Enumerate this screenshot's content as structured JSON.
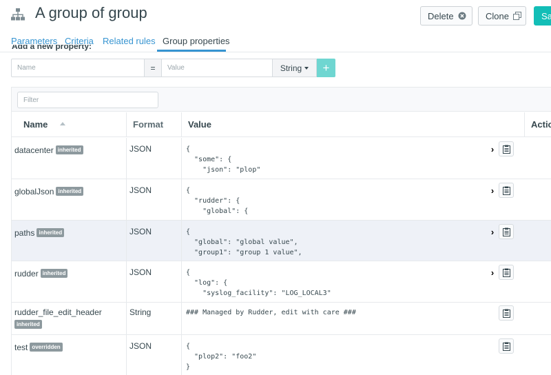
{
  "header": {
    "title": "A group of group",
    "delete_label": "Delete",
    "clone_label": "Clone",
    "save_label": "Sa"
  },
  "tabs": [
    {
      "label": "Parameters",
      "active": false
    },
    {
      "label": "Criteria",
      "active": false
    },
    {
      "label": "Related rules",
      "active": false
    },
    {
      "label": "Group properties",
      "active": true
    }
  ],
  "add_property": {
    "label": "Add a new property:",
    "name_placeholder": "Name",
    "equals": "=",
    "value_placeholder": "Value",
    "type_value": "String",
    "add_label": "+"
  },
  "table": {
    "filter_placeholder": "Filter",
    "columns": {
      "name": "Name",
      "format": "Format",
      "value": "Value",
      "action": "Actio"
    },
    "rows": [
      {
        "name": "datacenter",
        "badge": "inherited",
        "format": "JSON",
        "value": "{\n  \"some\": {\n    \"json\": \"plop\"",
        "expandable": true
      },
      {
        "name": "globalJson",
        "badge": "inherited",
        "format": "JSON",
        "value": "{\n  \"rudder\": {\n    \"global\": {",
        "expandable": true
      },
      {
        "name": "paths",
        "badge": "inherited",
        "format": "JSON",
        "value": "{\n  \"global\": \"global value\",\n  \"group1\": \"group 1 value\",",
        "expandable": true
      },
      {
        "name": "rudder",
        "badge": "inherited",
        "format": "JSON",
        "value": "{\n  \"log\": {\n    \"syslog_facility\": \"LOG_LOCAL3\"",
        "expandable": true
      },
      {
        "name": "rudder_file_edit_header",
        "badge": "inherited",
        "format": "String",
        "value": "### Managed by Rudder, edit with care ###",
        "expandable": false
      },
      {
        "name": "test",
        "badge": "overridden",
        "format": "JSON",
        "value": "{\n  \"plop2\": \"foo2\"\n}",
        "expandable": false
      }
    ]
  },
  "colors": {
    "accent": "#3694d1",
    "save": "#13beb7",
    "add": "#6fd6d1",
    "badge": "#8d999e",
    "highlight_row": "#eef1f7"
  },
  "icons": {
    "group": "hierarchy-icon",
    "delete": "close-circle-icon",
    "clone": "copy-icon",
    "expand": "chevron-right-icon",
    "copy": "clipboard-icon"
  }
}
